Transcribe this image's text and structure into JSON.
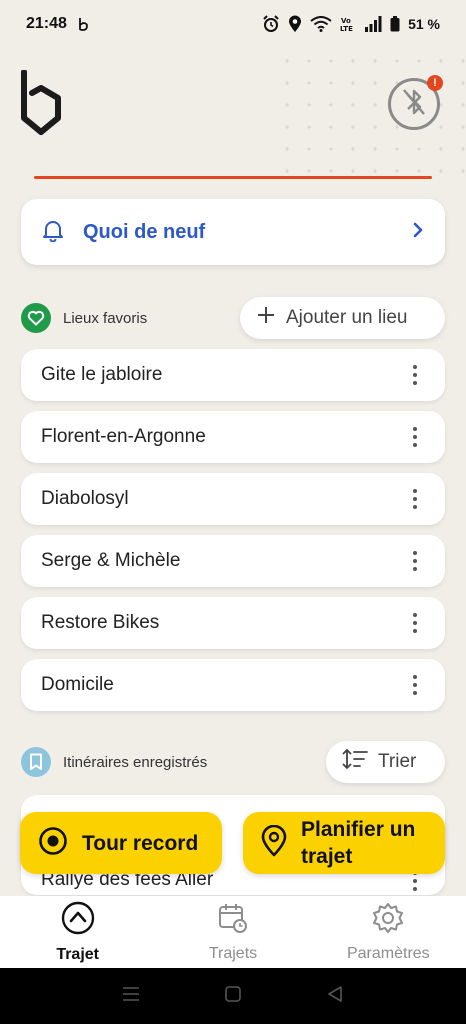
{
  "status_bar": {
    "time": "21:48",
    "battery": "51 %"
  },
  "header": {
    "bluetooth_badge": "!"
  },
  "news": {
    "label": "Quoi de neuf"
  },
  "favorites": {
    "title": "Lieux favoris",
    "add_button": "Ajouter un lieu",
    "items": [
      {
        "name": "Gite le jabloire"
      },
      {
        "name": "Florent-en-Argonne"
      },
      {
        "name": "Diabolosyl"
      },
      {
        "name": "Serge & Michèle"
      },
      {
        "name": "Restore Bikes"
      },
      {
        "name": "Domicile"
      }
    ]
  },
  "routes": {
    "title": "Itinéraires enregistrés",
    "sort_button": "Trier",
    "items": [
      {
        "name": "Rallye des fées Aller"
      }
    ]
  },
  "actions": {
    "tour_record": "Tour record",
    "plan_route": "Planifier un trajet"
  },
  "bottom_nav": {
    "trajet": "Trajet",
    "trajets": "Trajets",
    "parametres": "Paramètres"
  },
  "colors": {
    "accent_blue": "#2d59c8",
    "accent_yellow": "#fbd200",
    "favorite_green": "#1f9a48",
    "route_blue": "#8ec5de",
    "alert_red": "#e4471f"
  }
}
